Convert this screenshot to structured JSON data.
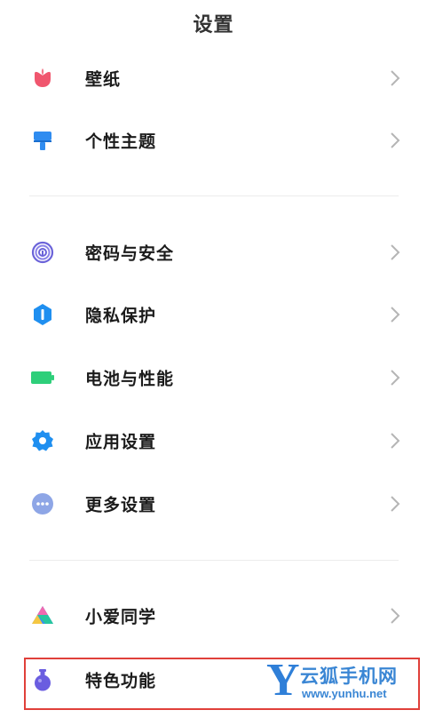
{
  "header": {
    "title": "设置"
  },
  "groups": [
    {
      "items": [
        {
          "label": "壁纸",
          "icon": "tulip-icon"
        },
        {
          "label": "个性主题",
          "icon": "paintbrush-icon"
        }
      ]
    },
    {
      "items": [
        {
          "label": "密码与安全",
          "icon": "fingerprint-icon"
        },
        {
          "label": "隐私保护",
          "icon": "privacy-shield-icon"
        },
        {
          "label": "电池与性能",
          "icon": "battery-icon"
        },
        {
          "label": "应用设置",
          "icon": "gear-icon"
        },
        {
          "label": "更多设置",
          "icon": "more-dots-icon"
        }
      ]
    },
    {
      "items": [
        {
          "label": "小爱同学",
          "icon": "xiaoai-icon"
        },
        {
          "label": "特色功能",
          "icon": "potion-flask-icon"
        }
      ]
    }
  ],
  "watermark": {
    "letter": "Y",
    "name": "云狐手机网",
    "url": "www.yunhu.net"
  },
  "colors": {
    "wallpaper": "#f0566e",
    "theme": "#2f8cf0",
    "security": "#6b63d9",
    "privacy": "#1f8ff0",
    "battery": "#2ecf7a",
    "apps": "#1f8ff0",
    "more": "#8ea6e6",
    "features": "#6a5de0",
    "highlight": "#e0403a"
  }
}
